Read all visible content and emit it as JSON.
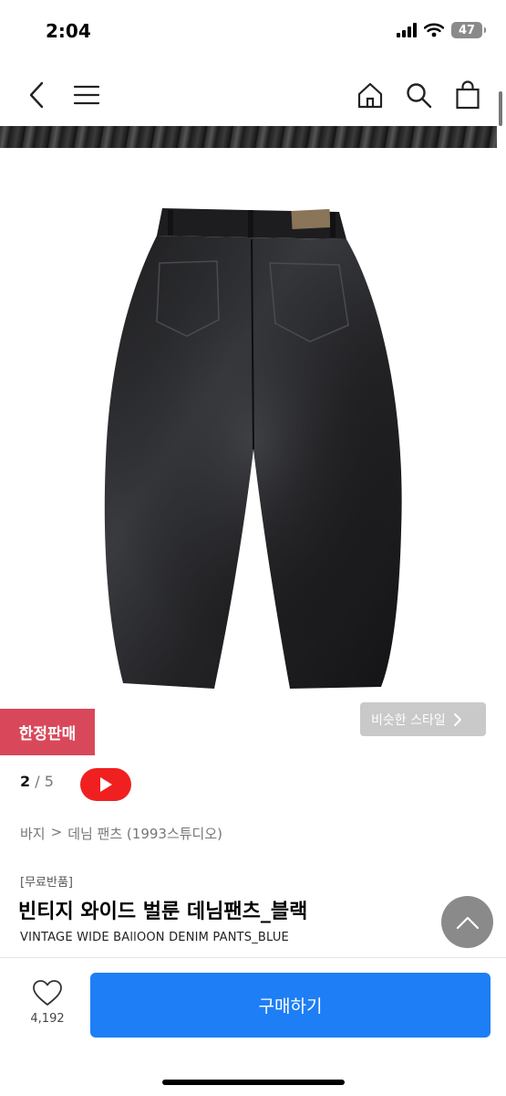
{
  "status_bar": {
    "time": "2:04",
    "battery_level": "47"
  },
  "nav": {
    "back_icon": "chevron-left-icon",
    "menu_icon": "hamburger-icon",
    "home_icon": "house-icon",
    "search_icon": "search-icon",
    "cart_icon": "shopping-bag-icon"
  },
  "product": {
    "image_alt_icon": "black-wide-denim-pants-image",
    "limited_badge": "한정판매",
    "similar_style": "비슷한 스타일",
    "gallery": {
      "current": "2",
      "separator": "/",
      "total": "5"
    },
    "breadcrumb": [
      "바지",
      ">",
      "데님 팬츠 (1993스튜디오)"
    ],
    "tag": "[무료반품]",
    "title": "빈티지 와이드 벌룬 데님팬츠_블랙",
    "subtitle": "VINTAGE WIDE BAllOON DENIM PANTS_BLUE"
  },
  "bottom_bar": {
    "like_count": "4,192",
    "buy_label": "구매하기"
  },
  "colors": {
    "badge": "#d9485a",
    "buy_button": "#1e7ef5",
    "video_button": "#f02020"
  }
}
